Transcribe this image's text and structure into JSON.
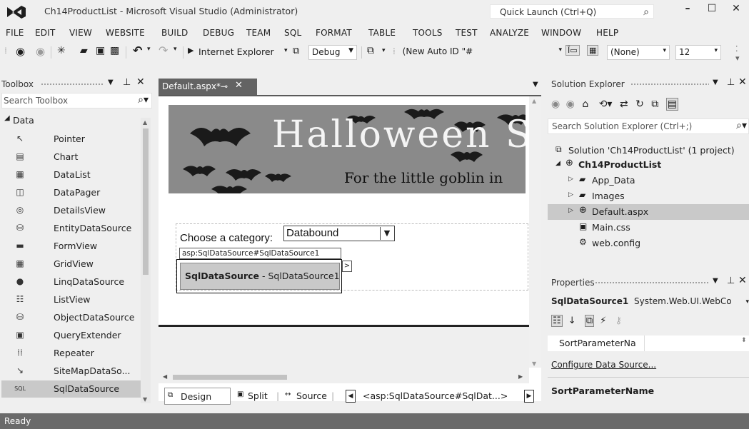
{
  "window": {
    "title": "Ch14ProductList - Microsoft Visual Studio (Administrator)",
    "quick_launch_placeholder": "Quick Launch (Ctrl+Q)",
    "minimize": "–",
    "maximize": "☐",
    "close": "✕"
  },
  "menu": [
    "FILE",
    "EDIT",
    "VIEW",
    "WEBSITE",
    "BUILD",
    "DEBUG",
    "TEAM",
    "SQL",
    "FORMAT",
    "TABLE",
    "TOOLS",
    "TEST",
    "ANALYZE",
    "WINDOW",
    "HELP"
  ],
  "toolbar": {
    "browser_label": "Internet Explorer",
    "config_value": "Debug",
    "style_combo": "(New Auto ID \"#",
    "font_combo": "(None)",
    "size_combo": "12"
  },
  "toolbox": {
    "title": "Toolbox",
    "search_placeholder": "Search Toolbox",
    "group": "Data",
    "items": [
      {
        "label": "Pointer",
        "icon": "pointer-icon",
        "glyph": "↖"
      },
      {
        "label": "Chart",
        "icon": "chart-icon",
        "glyph": "▤"
      },
      {
        "label": "DataList",
        "icon": "datalist-icon",
        "glyph": "▦"
      },
      {
        "label": "DataPager",
        "icon": "datapager-icon",
        "glyph": "◫"
      },
      {
        "label": "DetailsView",
        "icon": "detailsview-icon",
        "glyph": "◎"
      },
      {
        "label": "EntityDataSource",
        "icon": "entitydatasource-icon",
        "glyph": "⛁"
      },
      {
        "label": "FormView",
        "icon": "formview-icon",
        "glyph": "▬"
      },
      {
        "label": "GridView",
        "icon": "gridview-icon",
        "glyph": "▦"
      },
      {
        "label": "LinqDataSource",
        "icon": "linqdatasource-icon",
        "glyph": "●"
      },
      {
        "label": "ListView",
        "icon": "listview-icon",
        "glyph": "☷"
      },
      {
        "label": "ObjectDataSource",
        "icon": "objectdatasource-icon",
        "glyph": "⛁"
      },
      {
        "label": "QueryExtender",
        "icon": "queryextender-icon",
        "glyph": "▣"
      },
      {
        "label": "Repeater",
        "icon": "repeater-icon",
        "glyph": "⁞⁞"
      },
      {
        "label": "SiteMapDataSo...",
        "icon": "sitemapdatasource-icon",
        "glyph": "↘"
      },
      {
        "label": "SqlDataSource",
        "icon": "sqldatasource-icon",
        "glyph": "SQL"
      }
    ]
  },
  "document": {
    "tab_label": "Default.aspx*",
    "banner_title": "Halloween Su",
    "banner_subtitle": "For the little goblin in",
    "choose_label": "Choose a category:",
    "dropdown_value": "Databound",
    "sds_tag": "asp:SqlDataSource#SqlDataSource1",
    "sds_bold": "SqlDataSource",
    "sds_rest": " - SqlDataSource1",
    "smart_tag": ">"
  },
  "editor_bottom": {
    "design": "Design",
    "split": "Split",
    "source": "Source",
    "breadcrumb": "<asp:SqlDataSource#SqlDat...>"
  },
  "solution_explorer": {
    "title": "Solution Explorer",
    "search_placeholder": "Search Solution Explorer (Ctrl+;)",
    "solution": "Solution 'Ch14ProductList' (1 project)",
    "project": "Ch14ProductList",
    "items": [
      "App_Data",
      "Images",
      "Default.aspx",
      "Main.css",
      "web.config"
    ]
  },
  "properties": {
    "title": "Properties",
    "object_name": "SqlDataSource1",
    "object_type": "System.Web.UI.WebCo",
    "row_name": "SortParameterNa",
    "configure_link": "Configure Data Source...",
    "description_title": "SortParameterName"
  },
  "status": {
    "text": "Ready"
  },
  "colors": {
    "accent": "#68217a",
    "status_bar": "#6a6a6a",
    "selection": "#c9c9c9"
  }
}
